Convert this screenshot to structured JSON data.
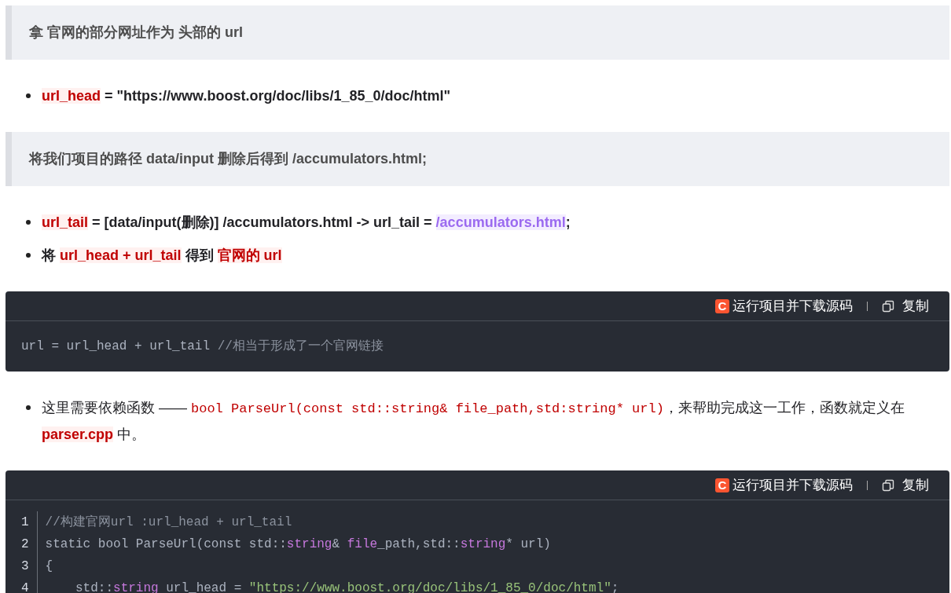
{
  "blocks": [
    {
      "kind": "quote",
      "text": "拿 官网的部分网址作为 头部的 url"
    },
    {
      "kind": "bullets",
      "items": [
        {
          "bold": true,
          "segments": [
            {
              "kind": "mark",
              "text": "url_head"
            },
            {
              "kind": "plain",
              "text": " =  \"https://www.boost.org/doc/libs/1_85_0/doc/html\""
            }
          ]
        }
      ]
    },
    {
      "kind": "quote",
      "text": "将我们项目的路径 data/input 删除后得到 /accumulators.html;"
    },
    {
      "kind": "bullets",
      "items": [
        {
          "bold": true,
          "segments": [
            {
              "kind": "mark",
              "text": "url_tail"
            },
            {
              "kind": "plain",
              "text": " = [data/input(删除)] /accumulators.html -> url_tail = "
            },
            {
              "kind": "hl",
              "text": "/accumulators.html"
            },
            {
              "kind": "plain",
              "text": ";"
            }
          ]
        },
        {
          "bold": true,
          "segments": [
            {
              "kind": "plain",
              "text": "将 "
            },
            {
              "kind": "mark",
              "text": "url_head +  url_tail"
            },
            {
              "kind": "plain",
              "text": " 得到 "
            },
            {
              "kind": "mark",
              "text": "官网的 url"
            }
          ]
        }
      ]
    },
    {
      "kind": "code",
      "badge": "C",
      "run_label": "运行项目并下载源码",
      "copy_label": "复制",
      "numbered": false,
      "lines": [
        {
          "tokens": [
            {
              "kind": "plain",
              "text": "url = url_head + url_tail "
            },
            {
              "kind": "comment",
              "text": "//相当于形成了一个官网链接"
            }
          ]
        }
      ]
    },
    {
      "kind": "bullets",
      "items": [
        {
          "bold": false,
          "segments": [
            {
              "kind": "plain",
              "text": "这里需要依赖函数 —— "
            },
            {
              "kind": "mono",
              "text": "bool ParseUrl(const std::string& file_path,std:string* url)"
            },
            {
              "kind": "plain",
              "text": "，来帮助完成这一工作，函数就定义在 "
            },
            {
              "kind": "mark",
              "text": "parser.cpp"
            },
            {
              "kind": "plain",
              "text": " 中。"
            }
          ]
        }
      ]
    },
    {
      "kind": "code",
      "badge": "C",
      "run_label": "运行项目并下载源码",
      "copy_label": "复制",
      "numbered": true,
      "lines": [
        {
          "number": "1",
          "tokens": [
            {
              "kind": "comment",
              "text": "//构建官网url :url_head + url_tail"
            }
          ]
        },
        {
          "number": "2",
          "tokens": [
            {
              "kind": "plain",
              "text": "static bool ParseUrl(const std::"
            },
            {
              "kind": "type",
              "text": "string"
            },
            {
              "kind": "plain",
              "text": "& "
            },
            {
              "kind": "type",
              "text": "file"
            },
            {
              "kind": "plain",
              "text": "_path,std::"
            },
            {
              "kind": "type",
              "text": "string"
            },
            {
              "kind": "plain",
              "text": "* url)"
            }
          ]
        },
        {
          "number": "3",
          "tokens": [
            {
              "kind": "plain",
              "text": "{"
            }
          ]
        },
        {
          "number": "4",
          "tokens": [
            {
              "kind": "plain",
              "text": "    std::"
            },
            {
              "kind": "type",
              "text": "string"
            },
            {
              "kind": "plain",
              "text": " url_head = "
            },
            {
              "kind": "string",
              "text": "\"https://www.boost.org/doc/libs/1_85_0/doc/html\""
            },
            {
              "kind": "plain",
              "text": ";"
            }
          ]
        }
      ]
    }
  ]
}
